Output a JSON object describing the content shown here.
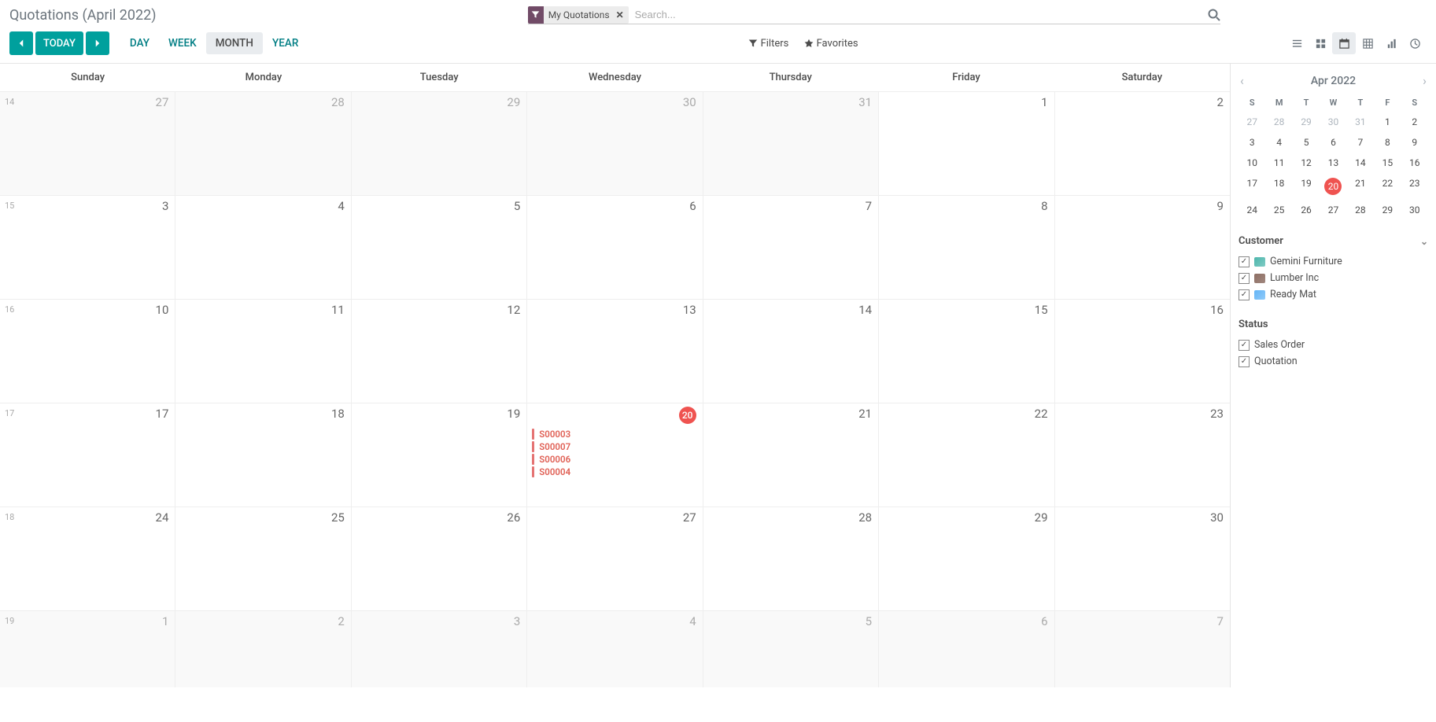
{
  "breadcrumb": "Quotations (April 2022)",
  "search": {
    "facet_label": "My Quotations",
    "placeholder": "Search..."
  },
  "nav": {
    "today": "TODAY",
    "ranges": {
      "day": "DAY",
      "week": "WEEK",
      "month": "MONTH",
      "year": "YEAR"
    }
  },
  "toolbar": {
    "filters": "Filters",
    "favorites": "Favorites"
  },
  "calendar": {
    "day_names": [
      "Sunday",
      "Monday",
      "Tuesday",
      "Wednesday",
      "Thursday",
      "Friday",
      "Saturday"
    ],
    "weeks": [
      {
        "num": "14",
        "days": [
          {
            "n": "27",
            "other": true
          },
          {
            "n": "28",
            "other": true
          },
          {
            "n": "29",
            "other": true
          },
          {
            "n": "30",
            "other": true
          },
          {
            "n": "31",
            "other": true
          },
          {
            "n": "1"
          },
          {
            "n": "2"
          }
        ]
      },
      {
        "num": "15",
        "days": [
          {
            "n": "3"
          },
          {
            "n": "4"
          },
          {
            "n": "5"
          },
          {
            "n": "6"
          },
          {
            "n": "7"
          },
          {
            "n": "8"
          },
          {
            "n": "9"
          }
        ]
      },
      {
        "num": "16",
        "days": [
          {
            "n": "10"
          },
          {
            "n": "11"
          },
          {
            "n": "12"
          },
          {
            "n": "13"
          },
          {
            "n": "14"
          },
          {
            "n": "15"
          },
          {
            "n": "16"
          }
        ]
      },
      {
        "num": "17",
        "days": [
          {
            "n": "17"
          },
          {
            "n": "18"
          },
          {
            "n": "19"
          },
          {
            "n": "20",
            "today": true,
            "events": [
              "S00003",
              "S00007",
              "S00006",
              "S00004"
            ]
          },
          {
            "n": "21"
          },
          {
            "n": "22"
          },
          {
            "n": "23"
          }
        ]
      },
      {
        "num": "18",
        "days": [
          {
            "n": "24"
          },
          {
            "n": "25"
          },
          {
            "n": "26"
          },
          {
            "n": "27"
          },
          {
            "n": "28"
          },
          {
            "n": "29"
          },
          {
            "n": "30"
          }
        ]
      },
      {
        "num": "19",
        "days": [
          {
            "n": "1",
            "other": true
          },
          {
            "n": "2",
            "other": true
          },
          {
            "n": "3",
            "other": true
          },
          {
            "n": "4",
            "other": true
          },
          {
            "n": "5",
            "other": true
          },
          {
            "n": "6",
            "other": true
          },
          {
            "n": "7",
            "other": true
          }
        ]
      }
    ]
  },
  "mini": {
    "title": "Apr 2022",
    "day_heads": [
      "S",
      "M",
      "T",
      "W",
      "T",
      "F",
      "S"
    ],
    "cells": [
      {
        "n": "27",
        "o": true
      },
      {
        "n": "28",
        "o": true
      },
      {
        "n": "29",
        "o": true
      },
      {
        "n": "30",
        "o": true
      },
      {
        "n": "31",
        "o": true
      },
      {
        "n": "1"
      },
      {
        "n": "2"
      },
      {
        "n": "3"
      },
      {
        "n": "4"
      },
      {
        "n": "5"
      },
      {
        "n": "6"
      },
      {
        "n": "7"
      },
      {
        "n": "8"
      },
      {
        "n": "9"
      },
      {
        "n": "10"
      },
      {
        "n": "11"
      },
      {
        "n": "12"
      },
      {
        "n": "13"
      },
      {
        "n": "14"
      },
      {
        "n": "15"
      },
      {
        "n": "16"
      },
      {
        "n": "17"
      },
      {
        "n": "18"
      },
      {
        "n": "19"
      },
      {
        "n": "20",
        "t": true
      },
      {
        "n": "21"
      },
      {
        "n": "22"
      },
      {
        "n": "23"
      },
      {
        "n": "24"
      },
      {
        "n": "25"
      },
      {
        "n": "26"
      },
      {
        "n": "27"
      },
      {
        "n": "28"
      },
      {
        "n": "29"
      },
      {
        "n": "30"
      }
    ]
  },
  "side": {
    "customer_label": "Customer",
    "customers": [
      "Gemini Furniture",
      "Lumber Inc",
      "Ready Mat"
    ],
    "status_label": "Status",
    "statuses": [
      "Sales Order",
      "Quotation"
    ]
  }
}
